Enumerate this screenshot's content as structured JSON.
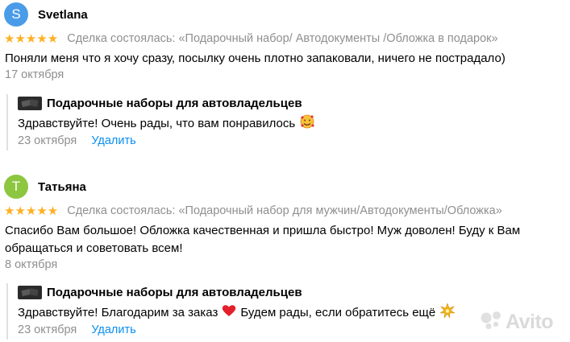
{
  "reviews": [
    {
      "avatar_letter": "S",
      "avatar_color": "#4a9ce8",
      "author": "Svetlana",
      "stars": "★★★★★",
      "deal": "Сделка состоялась: «Подарочный набор/ Автодокументы /Обложка в подарок»",
      "text": "Поняли меня что я хочу сразу, посылку очень плотно запаковали, ничего не пострадало)",
      "date": "17 октября",
      "reply": {
        "seller_name": "Подарочные наборы для автовладельцев",
        "text": "Здравствуйте! Очень рады, что вам понравилось",
        "date": "23 октября",
        "delete_label": "Удалить"
      }
    },
    {
      "avatar_letter": "Т",
      "avatar_color": "#8dc63f",
      "author": "Татьяна",
      "stars": "★★★★★",
      "deal": "Сделка состоялась: «Подарочный набор для мужчин/Автодокументы/Обложка»",
      "text": "Спасибо Вам большое! Обложка качественная и пришла быстро! Муж доволен! Буду к Вам обращаться и советовать всем!",
      "date": "8 октября",
      "reply": {
        "seller_name": "Подарочные наборы для автовладельцев",
        "text_part1": "Здравствуйте! Благодарим за заказ",
        "text_part2": "Будем рады, если обратитесь ещё",
        "date": "23 октября",
        "delete_label": "Удалить"
      }
    }
  ],
  "watermark": {
    "text": "Avito",
    "color": "#bdbdbd"
  },
  "icons": {
    "star": "star-icon",
    "heart_eyes_emoji": "smiling-face-with-hearts-icon",
    "heart_emoji": "red-heart-icon",
    "sparkle_emoji": "sparkle-icon",
    "logo": "avito-logo-icon"
  }
}
